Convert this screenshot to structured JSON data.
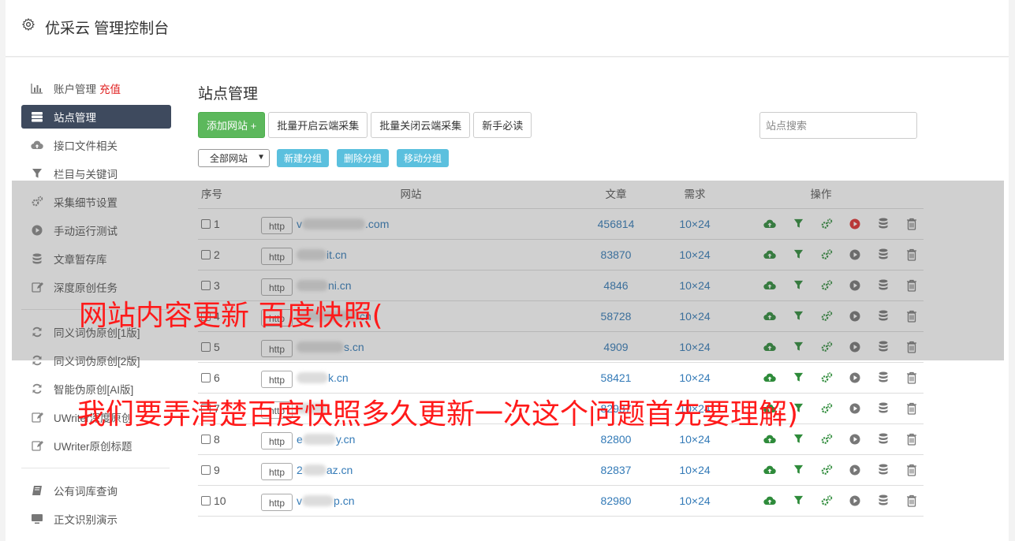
{
  "header": {
    "title": "优采云 管理控制台"
  },
  "sidebar": {
    "items": [
      {
        "label": "账户管理",
        "extra": "充值",
        "icon": "bar-chart-icon"
      },
      {
        "label": "站点管理",
        "icon": "server-icon",
        "active": true
      },
      {
        "label": "接口文件相关",
        "icon": "cloud-upload-icon"
      },
      {
        "label": "栏目与关键词",
        "icon": "filter-icon"
      },
      {
        "label": "采集细节设置",
        "icon": "cogs-icon"
      },
      {
        "label": "手动运行测试",
        "icon": "play-icon"
      },
      {
        "label": "文章暂存库",
        "icon": "database-icon"
      },
      {
        "label": "深度原创任务",
        "icon": "edit-icon"
      },
      {
        "label": "同义词伪原创[1版]",
        "icon": "refresh-icon"
      },
      {
        "label": "同义词伪原创[2版]",
        "icon": "refresh-icon"
      },
      {
        "label": "智能伪原创[AI版]",
        "icon": "refresh-icon"
      },
      {
        "label": "UWriter深度原创",
        "icon": "edit-icon"
      },
      {
        "label": "UWriter原创标题",
        "icon": "edit-icon"
      },
      {
        "label": "公有词库查询",
        "icon": "book-icon"
      },
      {
        "label": "正文识别演示",
        "icon": "monitor-icon"
      }
    ]
  },
  "main": {
    "title": "站点管理",
    "buttons": {
      "add_site": "添加网站 +",
      "batch_open": "批量开启云端采集",
      "batch_close": "批量关闭云端采集",
      "guide": "新手必读"
    },
    "search_placeholder": "站点搜索",
    "group_select": "全部网站",
    "group_buttons": {
      "new": "新建分组",
      "delete": "删除分组",
      "move": "移动分组"
    }
  },
  "table": {
    "headers": {
      "no": "序号",
      "site": "网站",
      "articles": "文章",
      "demand": "需求",
      "ops": "操作"
    },
    "rows": [
      {
        "no": "1",
        "prefix": "http",
        "d1": "v",
        "d2": ".com",
        "articles": "456814",
        "demand": "10×24"
      },
      {
        "no": "2",
        "prefix": "http",
        "d1": "",
        "d2": "it.cn",
        "articles": "83870",
        "demand": "10×24"
      },
      {
        "no": "3",
        "prefix": "http",
        "d1": "",
        "d2": "ni.cn",
        "articles": "4846",
        "demand": "10×24"
      },
      {
        "no": "4",
        "prefix": "http",
        "d1": "",
        "d2": "cn",
        "articles": "58728",
        "demand": "10×24"
      },
      {
        "no": "5",
        "prefix": "http",
        "d1": "",
        "d2": "s.cn",
        "articles": "4909",
        "demand": "10×24"
      },
      {
        "no": "6",
        "prefix": "http",
        "d1": "",
        "d2": "k.cn",
        "articles": "58421",
        "demand": "10×24"
      },
      {
        "no": "7",
        "prefix": "http",
        "d1": "",
        "d2": "",
        "articles": "82987",
        "demand": "10×24"
      },
      {
        "no": "8",
        "prefix": "http",
        "d1": "e",
        "d2": "y.cn",
        "articles": "82800",
        "demand": "10×24"
      },
      {
        "no": "9",
        "prefix": "http",
        "d1": "2",
        "d2": "az.cn",
        "articles": "82837",
        "demand": "10×24"
      },
      {
        "no": "10",
        "prefix": "http",
        "d1": "v",
        "d2": "p.cn",
        "articles": "82980",
        "demand": "10×24"
      }
    ]
  },
  "overlay": {
    "line1": "网站内容更新 百度快照(",
    "line2": "我们要弄清楚百度快照多久更新一次这个问题首先要理解)"
  },
  "colors": {
    "green": "#5cb85c",
    "active_nav": "#3e4a5e",
    "link": "#337ab7",
    "overlay_text": "#ff1a1a",
    "info": "#5bc0de"
  }
}
